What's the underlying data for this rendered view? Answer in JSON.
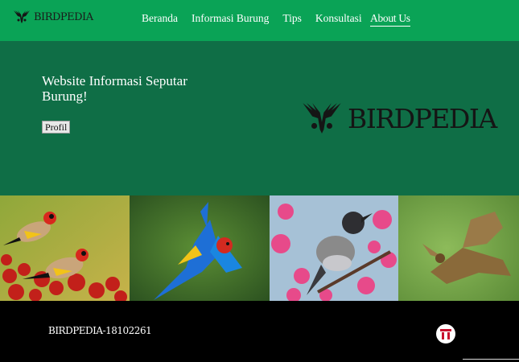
{
  "navbar": {
    "brand": "BIRDPEDIA",
    "links": [
      "Beranda",
      "Informasi Burung",
      "Tips",
      "Konsultasi"
    ],
    "active_link": "About Us"
  },
  "hero": {
    "title": "Website Informasi Seputar Burung!",
    "button_label": "Profil",
    "logo_text": "BIRDPEDIA"
  },
  "gallery": {
    "photos": [
      "goldfinch-photo",
      "macaw-photo",
      "sibia-photo",
      "hawk-photo"
    ]
  },
  "footer": {
    "text": "BIRDPEDIA-18102261",
    "badge_icon": "telkom-logo-icon"
  },
  "colors": {
    "nav_green": "#0aa356",
    "hero_green": "#0f6e46",
    "footer_black": "#000000",
    "badge_red": "#c8102e"
  }
}
